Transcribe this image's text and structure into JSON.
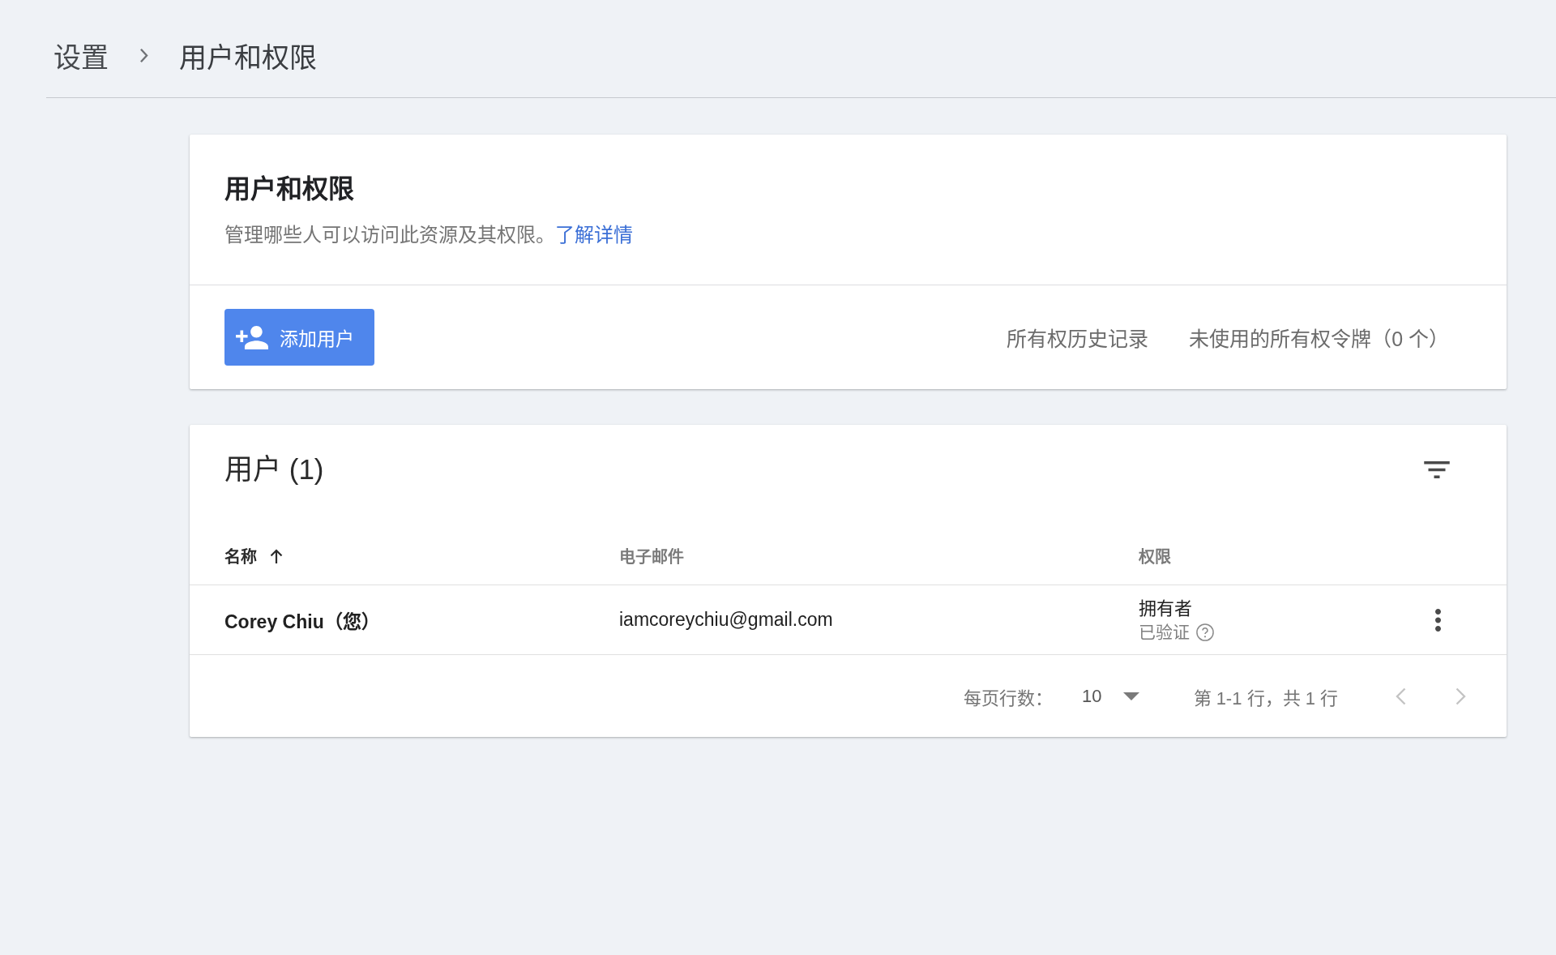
{
  "breadcrumb": [
    {
      "label": "设置"
    },
    {
      "label": "用户和权限"
    }
  ],
  "overview_card": {
    "title": "用户和权限",
    "description": "管理哪些人可以访问此资源及其权限。",
    "link": "了解详情",
    "add_button": "添加用户",
    "links": [
      "所有权历史记录",
      "未使用的所有权令牌（0 个）"
    ]
  },
  "users_card": {
    "title": "用户 (1)",
    "columns": [
      {
        "label": "名称",
        "sorted": true
      },
      {
        "label": "电子邮件",
        "sorted": false
      },
      {
        "label": "权限",
        "sorted": false
      }
    ],
    "rows": [
      {
        "name": "Corey Chiu（您）",
        "email": "iamcoreychiu@gmail.com",
        "permission": "拥有者",
        "status": "已验证"
      }
    ],
    "pagination": {
      "rows_per_page_label": "每页行数：",
      "rows_per_page": "10",
      "range": "第 1-1 行，共 1 行",
      "previous_disabled": true,
      "next_disabled": true
    }
  }
}
